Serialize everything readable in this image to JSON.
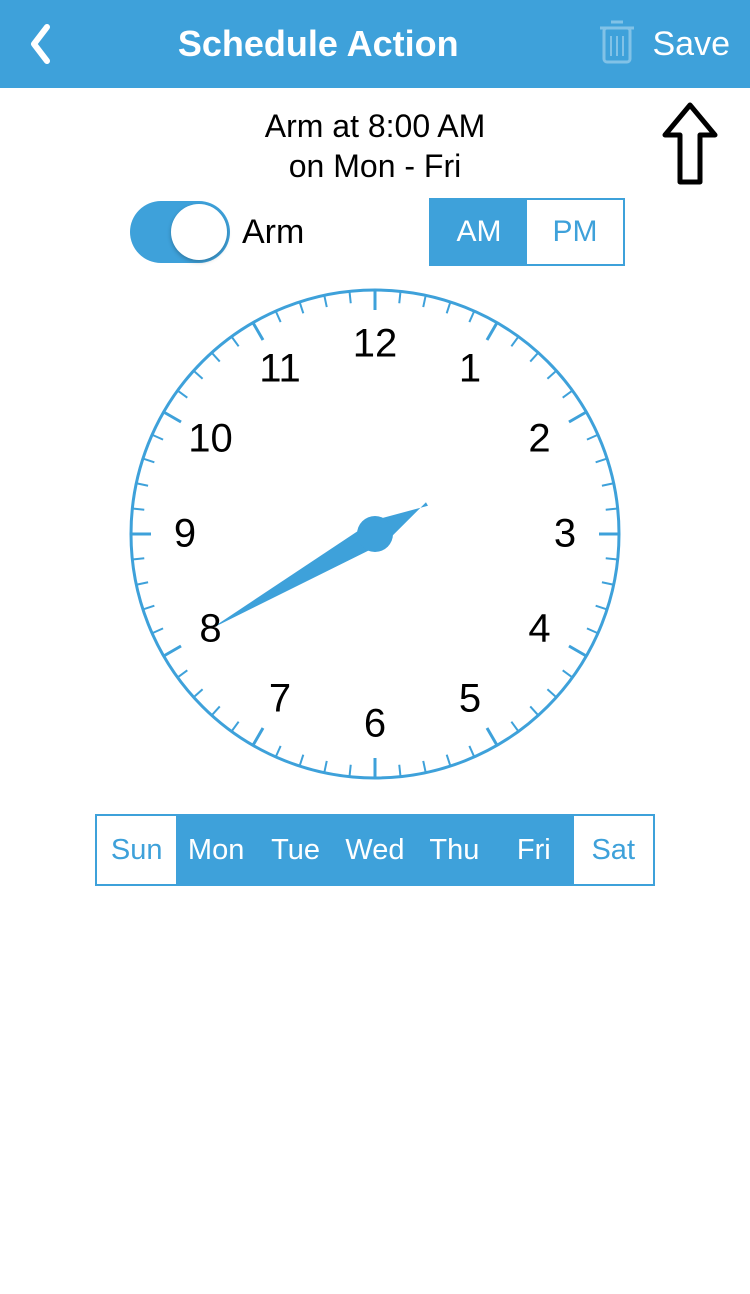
{
  "header": {
    "title": "Schedule Action",
    "save_label": "Save"
  },
  "summary": {
    "line1": "Arm at 8:00 AM",
    "line2": "on Mon - Fri"
  },
  "arm": {
    "on": true,
    "label": "Arm"
  },
  "ampm": {
    "am": "AM",
    "pm": "PM",
    "selected": "AM"
  },
  "clock": {
    "hour": 8,
    "minute": 0,
    "numbers": [
      "12",
      "1",
      "2",
      "3",
      "4",
      "5",
      "6",
      "7",
      "8",
      "9",
      "10",
      "11"
    ]
  },
  "days": [
    {
      "label": "Sun",
      "selected": false
    },
    {
      "label": "Mon",
      "selected": true
    },
    {
      "label": "Tue",
      "selected": true
    },
    {
      "label": "Wed",
      "selected": true
    },
    {
      "label": "Thu",
      "selected": true
    },
    {
      "label": "Fri",
      "selected": true
    },
    {
      "label": "Sat",
      "selected": false
    }
  ],
  "colors": {
    "accent": "#3ea1da"
  }
}
